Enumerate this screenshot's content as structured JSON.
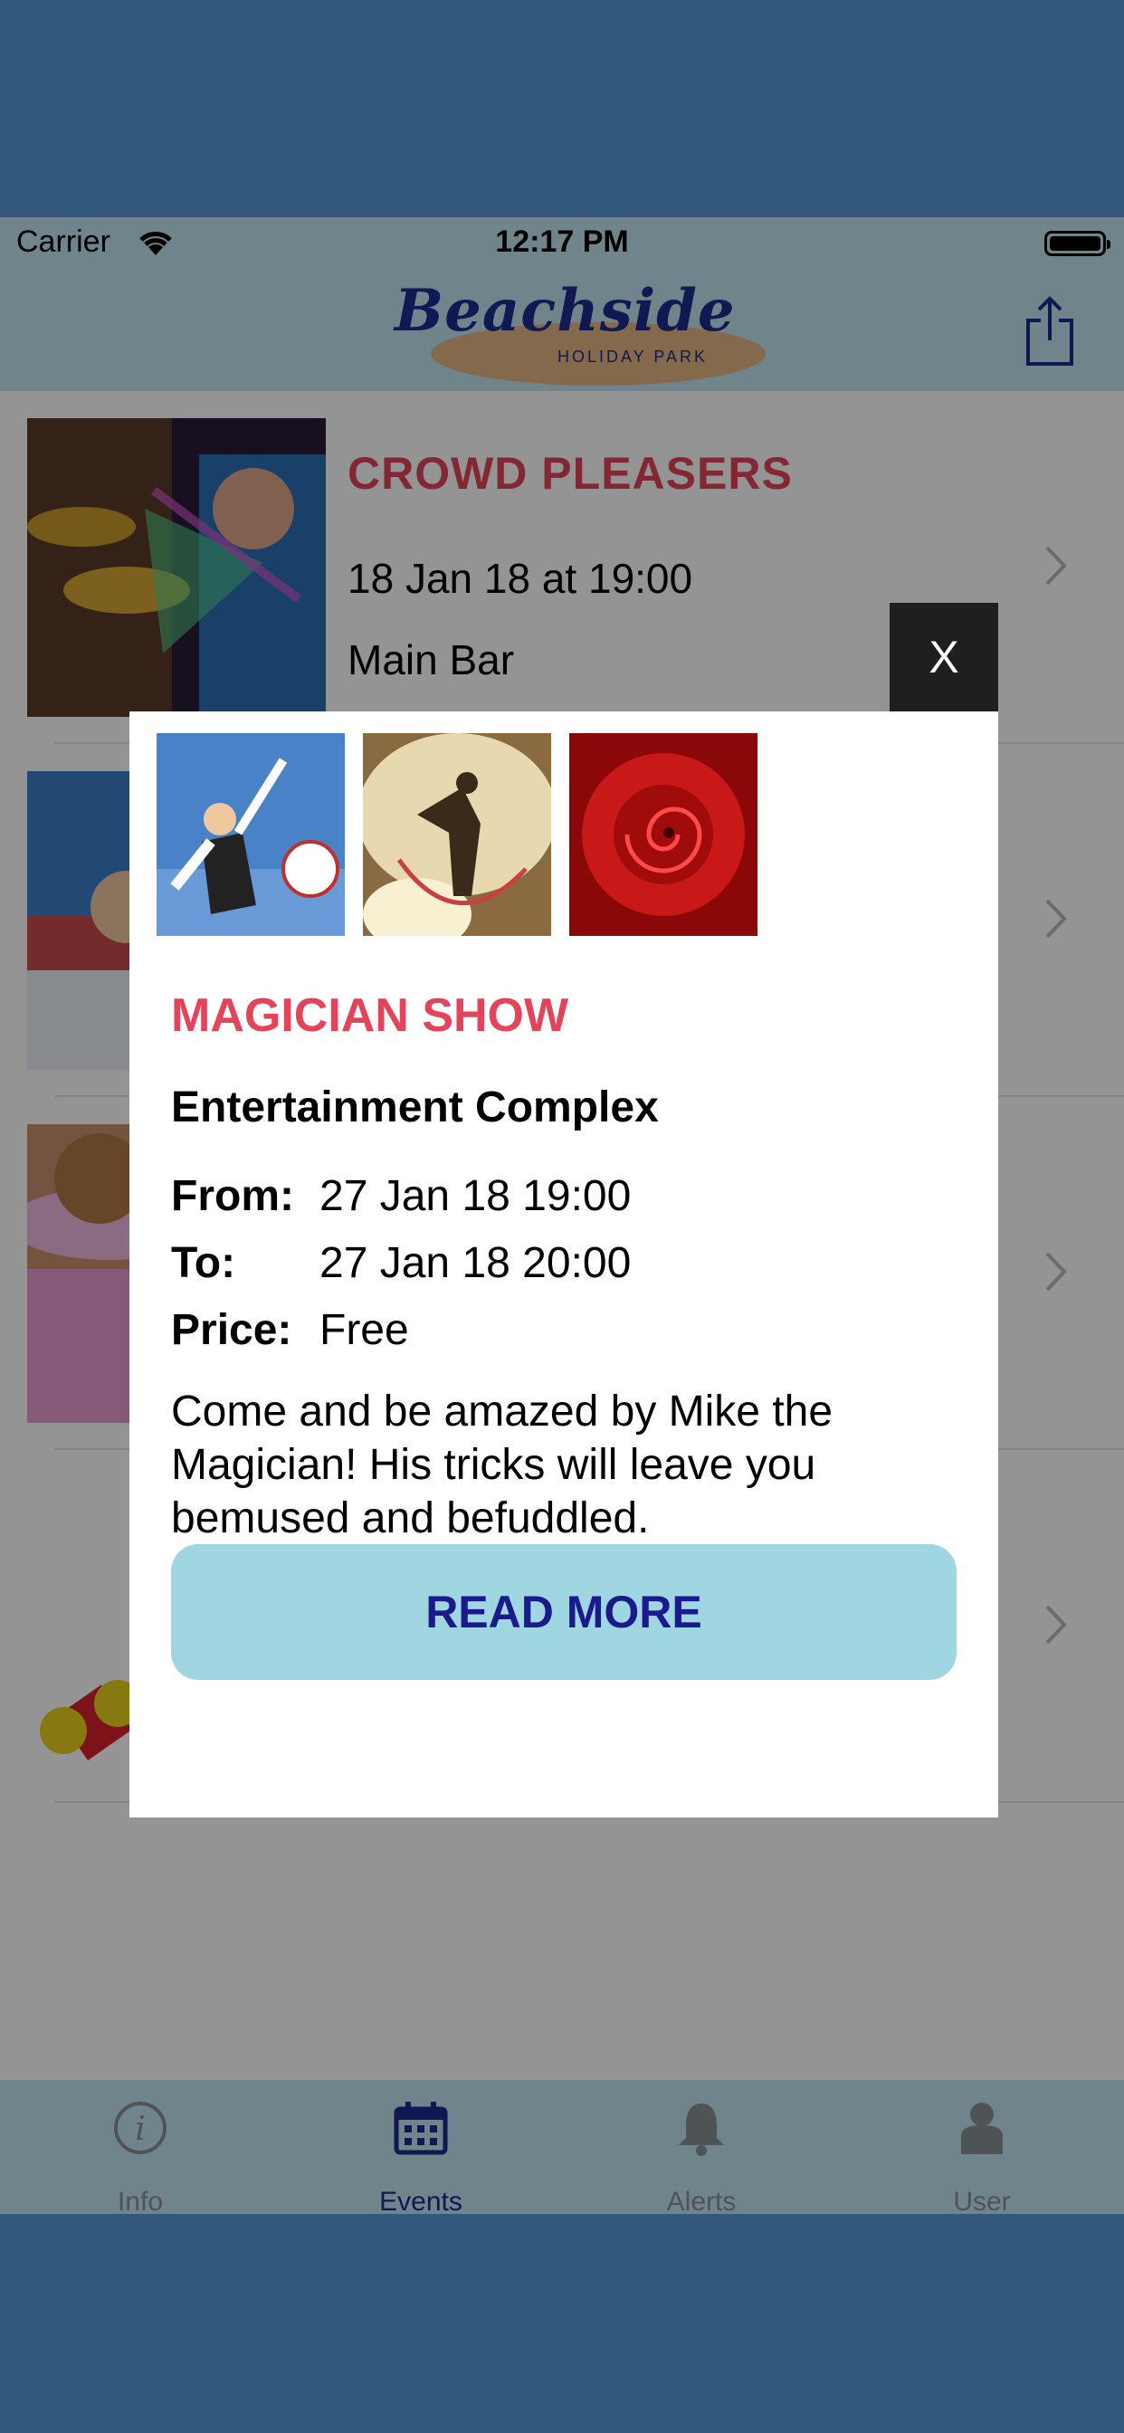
{
  "status_bar": {
    "carrier": "Carrier",
    "time": "12:17 PM"
  },
  "header": {
    "logo_text": "Beachside",
    "logo_subtext": "HOLIDAY PARK",
    "share_icon": "share-icon"
  },
  "events": [
    {
      "title": "CROWD PLEASERS",
      "date": "18 Jan 18 at 19:00",
      "venue": "Main Bar"
    },
    {
      "title": "",
      "date": "",
      "venue": ""
    },
    {
      "title": "",
      "date": "",
      "venue": ""
    },
    {
      "title": "",
      "date": "",
      "venue": ""
    }
  ],
  "modal": {
    "close_label": "X",
    "title": "MAGICIAN SHOW",
    "venue": "Entertainment Complex",
    "from_label": "From:",
    "from_value": "27 Jan 18 19:00",
    "to_label": "To:",
    "to_value": "27 Jan 18 20:00",
    "price_label": "Price:",
    "price_value": "Free",
    "description": "Come and be amazed by Mike the Magician! His tricks will leave you bemused and befuddled.",
    "button_label": "READ MORE"
  },
  "tabbar": {
    "tabs": [
      {
        "label": "Info",
        "icon": "info-icon"
      },
      {
        "label": "Events",
        "icon": "calendar-icon",
        "active": true
      },
      {
        "label": "Alerts",
        "icon": "bell-icon"
      },
      {
        "label": "User",
        "icon": "user-icon"
      }
    ]
  },
  "colors": {
    "brand_red": "#e3445a",
    "header_bg": "#bfe3ef",
    "button_bg": "#9fd6e2",
    "navy": "#1a2a8c"
  }
}
